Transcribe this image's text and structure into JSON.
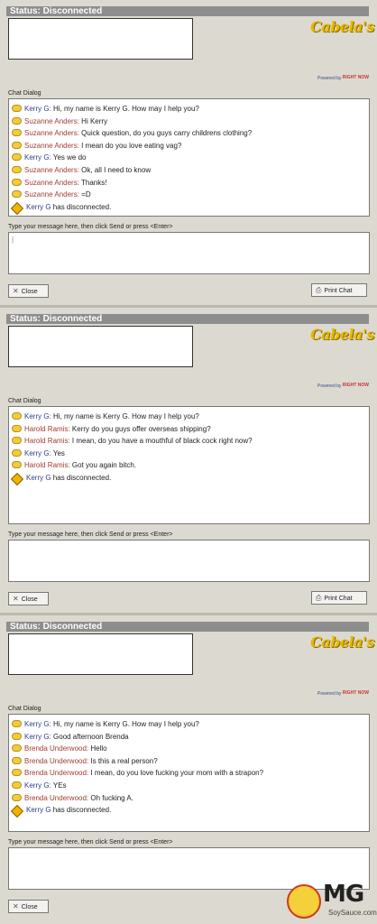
{
  "brand": "Cabela's",
  "powered_by": "Powered by",
  "powered_brand": "RIGHT NOW",
  "status_text": "Status: Disconnected",
  "chat_dialog_label": "Chat Dialog",
  "input_label": "Type your message here, then click Send or press <Enter>",
  "input_cursor": "|",
  "close_label": "Close",
  "print_label": "Print Chat",
  "watermark": {
    "logo": "MG",
    "site": "SoySauce.com"
  },
  "panels": [
    {
      "messages": [
        {
          "speaker": "Kerry G:",
          "role": "agent",
          "text": "Hi, my name is Kerry G. How may I help you?"
        },
        {
          "speaker": "Suzanne Anders:",
          "role": "customer",
          "text": "Hi Kerry"
        },
        {
          "speaker": "Suzanne Anders:",
          "role": "customer",
          "text": "Quick question, do you guys carry childrens clothing?"
        },
        {
          "speaker": "Suzanne Anders:",
          "role": "customer",
          "text": "I mean do you love eating vag?"
        },
        {
          "speaker": "Kerry G:",
          "role": "agent",
          "text": "Yes we do"
        },
        {
          "speaker": "Suzanne Anders:",
          "role": "customer",
          "text": "Ok, all I need to know"
        },
        {
          "speaker": "Suzanne Anders:",
          "role": "customer",
          "text": "Thanks!"
        },
        {
          "speaker": "Suzanne Anders:",
          "role": "customer",
          "text": "=D"
        },
        {
          "speaker": "Kerry G",
          "role": "system",
          "text": "has disconnected."
        }
      ]
    },
    {
      "messages": [
        {
          "speaker": "Kerry G:",
          "role": "agent",
          "text": "Hi, my name is Kerry G. How may I help you?"
        },
        {
          "speaker": "Harold Ramis:",
          "role": "customer",
          "text": "Kerry do you guys offer overseas shipping?"
        },
        {
          "speaker": "Harold Ramis:",
          "role": "customer",
          "text": "I mean, do you have a mouthful of black cock right now?"
        },
        {
          "speaker": "Kerry G:",
          "role": "agent",
          "text": "Yes"
        },
        {
          "speaker": "Harold Ramis:",
          "role": "customer",
          "text": "Got you again bitch."
        },
        {
          "speaker": "Kerry G",
          "role": "system",
          "text": "has disconnected."
        }
      ]
    },
    {
      "messages": [
        {
          "speaker": "Kerry G:",
          "role": "agent",
          "text": "Hi, my name is Kerry G. How may I help you?"
        },
        {
          "speaker": "Kerry G:",
          "role": "agent",
          "text": "Good afternoon Brenda"
        },
        {
          "speaker": "Brenda Underwood:",
          "role": "customer",
          "text": "Hello"
        },
        {
          "speaker": "Brenda Underwood:",
          "role": "customer",
          "text": "Is this a real person?"
        },
        {
          "speaker": "Brenda Underwood:",
          "role": "customer",
          "text": "I mean, do you love fucking your mom with a strapon?"
        },
        {
          "speaker": "Kerry G:",
          "role": "agent",
          "text": "YEs"
        },
        {
          "speaker": "Brenda Underwood:",
          "role": "customer",
          "text": "Oh fucking A."
        },
        {
          "speaker": "Kerry G",
          "role": "system",
          "text": "has disconnected."
        }
      ]
    }
  ]
}
